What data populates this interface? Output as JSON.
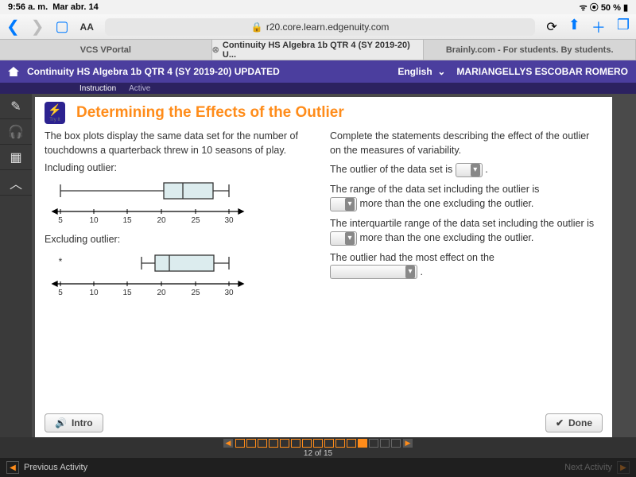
{
  "status": {
    "time": "9:56 a. m.",
    "date": "Mar abr. 14",
    "battery": "50 %",
    "wifi": "⚞ ⊚"
  },
  "safari": {
    "url": "r20.core.learn.edgenuity.com",
    "aa": "AA",
    "tabs": [
      {
        "label": "VCS VPortal"
      },
      {
        "label": "Continuity HS Algebra 1b QTR 4 (SY 2019-20) U..."
      },
      {
        "label": "Brainly.com - For students. By students."
      }
    ]
  },
  "course": {
    "title": "Continuity HS Algebra 1b QTR 4 (SY 2019-20) UPDATED",
    "language": "English",
    "user": "MARIANGELLYS ESCOBAR ROMERO",
    "sub1": "Instruction",
    "sub2": "Active"
  },
  "lesson": {
    "tryit": "Try It",
    "title": "Determining the Effects of the Outlier",
    "left_intro": "The box plots display the same data set for the number of touchdowns a quarterback threw in 10 seasons of play.",
    "label_incl": "Including outlier:",
    "label_excl": "Excluding outlier:",
    "right_intro": "Complete the statements describing the effect of the outlier on the measures of variability.",
    "s1a": "The outlier of the data set is ",
    "s1b": ".",
    "s2": "The range of the data set including the outlier is ",
    "s2b": " more than the one excluding the outlier.",
    "s3a": "The interquartile range of the data set including the outlier is ",
    "s3b": " more than the one excluding the outlier.",
    "s4": "The outlier had the most effect on the ",
    "s4b": "."
  },
  "buttons": {
    "intro": "Intro",
    "done": "Done"
  },
  "progress": {
    "label": "12 of 15"
  },
  "footer": {
    "prev": "Previous Activity",
    "next": "Next Activity"
  },
  "chart_data": [
    {
      "type": "boxplot",
      "title": "Including outlier",
      "axis_ticks": [
        5,
        10,
        15,
        20,
        25,
        30
      ],
      "min": 5,
      "q1": 18,
      "median": 21,
      "q3": 26,
      "max": 28
    },
    {
      "type": "boxplot",
      "title": "Excluding outlier",
      "axis_ticks": [
        5,
        10,
        15,
        20,
        25,
        30
      ],
      "outlier": 5,
      "min": 17,
      "q1": 19,
      "median": 21,
      "q3": 26,
      "max": 28
    }
  ]
}
